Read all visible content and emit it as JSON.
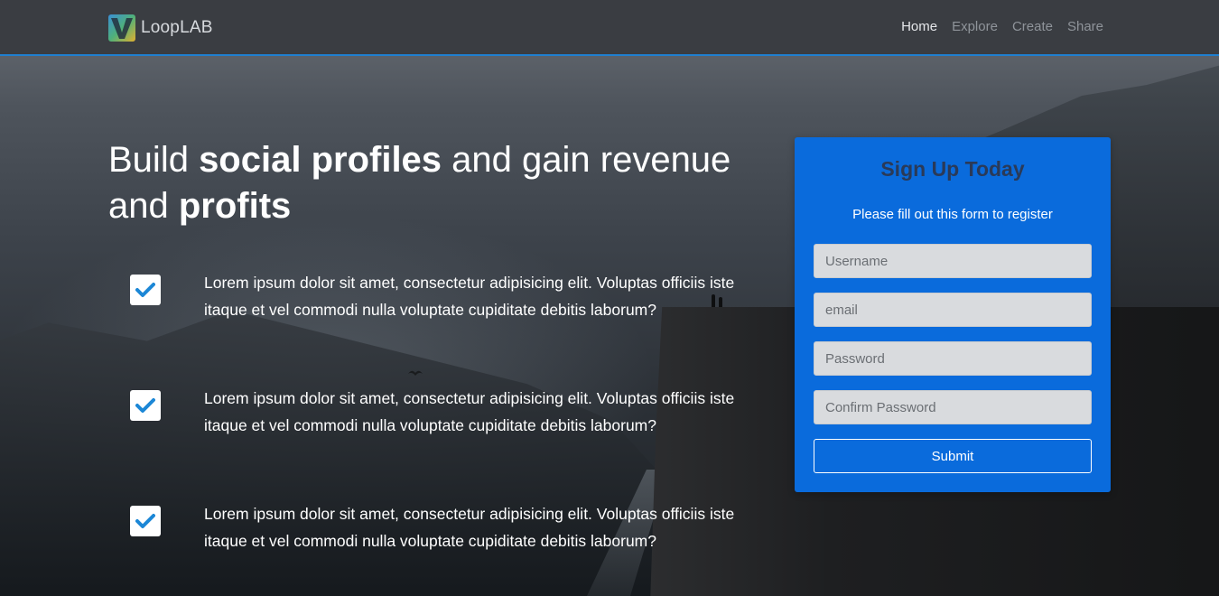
{
  "navbar": {
    "brand": "LoopLAB",
    "links": [
      {
        "label": "Home",
        "active": true
      },
      {
        "label": "Explore",
        "active": false
      },
      {
        "label": "Create",
        "active": false
      },
      {
        "label": "Share",
        "active": false
      }
    ]
  },
  "hero": {
    "headline": {
      "part1": "Build ",
      "bold1": "social profiles",
      "part2": " and gain revenue and ",
      "bold2": "profits"
    },
    "features": [
      {
        "text": "Lorem ipsum dolor sit amet, consectetur adipisicing elit. Voluptas officiis iste itaque et vel commodi nulla voluptate cupiditate debitis laborum?",
        "icon": "check-icon"
      },
      {
        "text": "Lorem ipsum dolor sit amet, consectetur adipisicing elit. Voluptas officiis iste itaque et vel commodi nulla voluptate cupiditate debitis laborum?",
        "icon": "check-icon"
      },
      {
        "text": "Lorem ipsum dolor sit amet, consectetur adipisicing elit. Voluptas officiis iste itaque et vel commodi nulla voluptate cupiditate debitis laborum?",
        "icon": "check-icon"
      }
    ]
  },
  "signup": {
    "title": "Sign Up Today",
    "subtitle": "Please fill out this form to register",
    "fields": {
      "username": {
        "placeholder": "Username",
        "value": ""
      },
      "email": {
        "placeholder": "email",
        "value": ""
      },
      "password": {
        "placeholder": "Password",
        "value": ""
      },
      "confirm": {
        "placeholder": "Confirm Password",
        "value": ""
      }
    },
    "submit_label": "Submit"
  },
  "colors": {
    "accent": "#0a6bdc",
    "navbar_bg": "#3a3d42",
    "navbar_border": "#1f7fd0",
    "check_color": "#1c87d6"
  }
}
